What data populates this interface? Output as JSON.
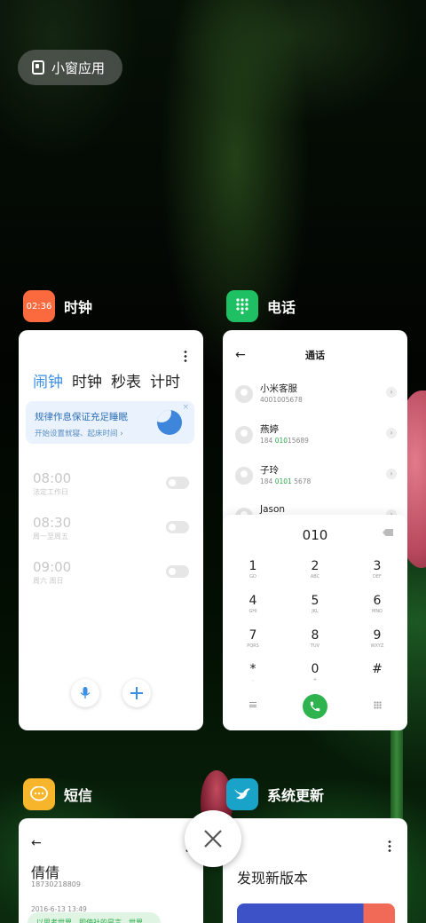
{
  "floating_window": {
    "label": "小窗应用"
  },
  "apps": {
    "clock": {
      "title": "时钟",
      "icon_text": "02:36",
      "tabs": [
        "闹钟",
        "时钟",
        "秒表",
        "计时"
      ],
      "banner": {
        "title": "规律作息保证充足睡眠",
        "subtitle": "开始设置就寝、起床时间 ›",
        "close": "×"
      },
      "alarms": [
        {
          "time": "08:00",
          "label": "法定工作日"
        },
        {
          "time": "08:30",
          "label": "周一至周五"
        },
        {
          "time": "09:00",
          "label": "周六 周日"
        }
      ]
    },
    "phone": {
      "title": "电话",
      "header": "通话",
      "back": "←",
      "contacts": [
        {
          "name": "小米客服",
          "number_pre": "",
          "number_hl": "",
          "number_post": "4001005678"
        },
        {
          "name": "燕婷",
          "number_pre": "184 ",
          "number_hl": "010",
          "number_post": "15689"
        },
        {
          "name": "子玲",
          "number_pre": "184 ",
          "number_hl": "0101",
          "number_post": " 5678"
        },
        {
          "name": "Jason",
          "number_pre": "",
          "number_hl": "",
          "number_post": ""
        }
      ],
      "dial_input": "010",
      "keys": [
        {
          "digit": "1",
          "letters": "GD"
        },
        {
          "digit": "2",
          "letters": "ABC"
        },
        {
          "digit": "3",
          "letters": "DEF"
        },
        {
          "digit": "4",
          "letters": "GHI"
        },
        {
          "digit": "5",
          "letters": "JKL"
        },
        {
          "digit": "6",
          "letters": "MNO"
        },
        {
          "digit": "7",
          "letters": "PQRS"
        },
        {
          "digit": "8",
          "letters": "TUV"
        },
        {
          "digit": "9",
          "letters": "WXYZ"
        },
        {
          "digit": "*",
          "letters": ","
        },
        {
          "digit": "0",
          "letters": "+"
        },
        {
          "digit": "#",
          "letters": ""
        }
      ]
    },
    "sms": {
      "title": "短信",
      "contact_name": "倩倩",
      "contact_number": "18730218809",
      "date": "2016-6-13 13:49",
      "message_preview": "以思考世界，即使社的是言，世界"
    },
    "update": {
      "title": "系统更新",
      "heading": "发现新版本"
    }
  },
  "colors": {
    "clock_icon": "#fa6a3e",
    "phone_icon": "#1fc063",
    "sms_icon": "#f7b52c",
    "update_icon": "#1aa3c8",
    "accent_blue": "#3a8ee6",
    "call_green": "#2fb34f"
  }
}
